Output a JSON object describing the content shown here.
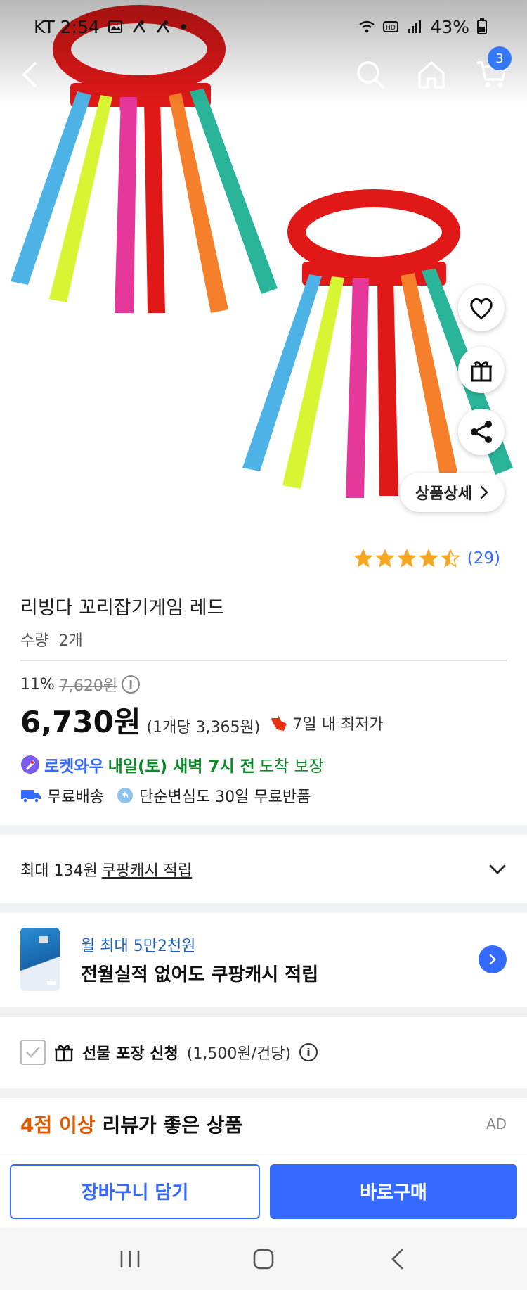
{
  "status_bar": {
    "carrier_time": "KT 2:54",
    "battery": "43%"
  },
  "nav": {
    "cart_count": "3"
  },
  "product": {
    "detail_button": "상품상세",
    "rating_stars": 4.5,
    "review_count": "(29)",
    "title": "리빙다 꼬리잡기게임 레드",
    "qty_label": "수량",
    "qty_value": "2개",
    "discount_rate": "11%",
    "original_price": "7,620원",
    "price": "6,730원",
    "unit_price": "(1개당 3,365원)",
    "lowest_price_note": "7일 내 최저가"
  },
  "delivery": {
    "rocket_brand": "로켓와우",
    "arrival_strong": "내일(토) 새벽 7시 전",
    "arrival_rest": "도착 보장",
    "free_shipping": "무료배송",
    "free_return": "단순변심도 30일 무료반품"
  },
  "cash": {
    "prefix": "최대 134원",
    "link": "쿠팡캐시 적립"
  },
  "card_promo": {
    "sub": "월 최대 5만2천원",
    "main": "전월실적 없어도 쿠팡캐시 적립"
  },
  "gift": {
    "label": "선물 포장 신청",
    "note": "(1,500원/건당)"
  },
  "reviews_section": {
    "accent": "4점 이상",
    "title": "리뷰가 좋은 상품",
    "ad": "AD"
  },
  "buy_bar": {
    "cart_button": "장바구니 담기",
    "buy_button": "바로구매"
  },
  "colors": {
    "accent": "#346aff",
    "arrival": "#0a8a29",
    "review_accent": "#e05a00",
    "star": "#f5a623"
  }
}
